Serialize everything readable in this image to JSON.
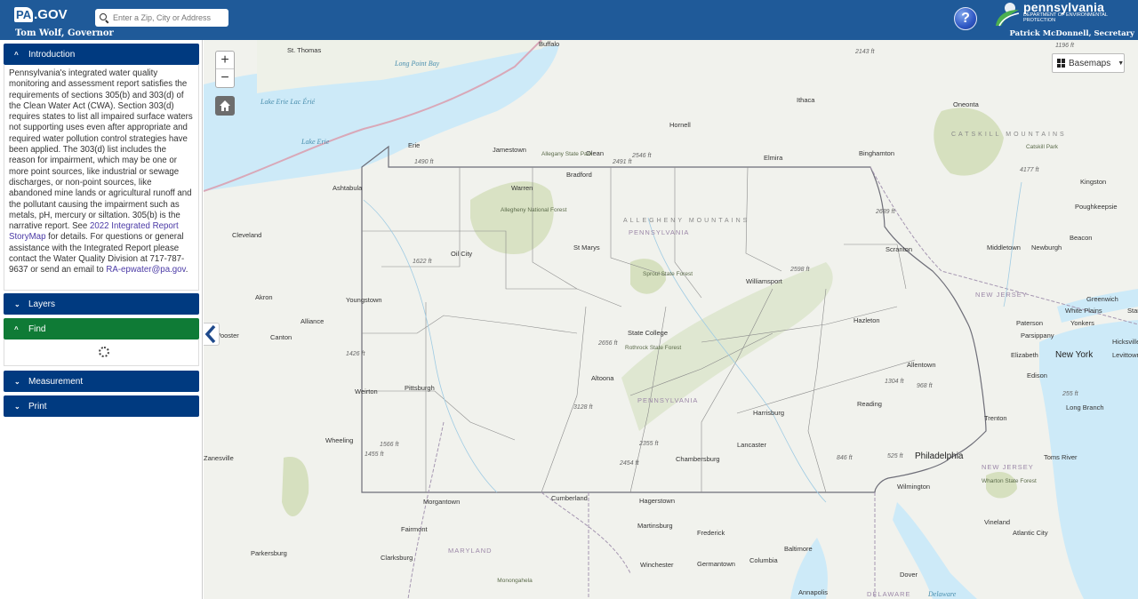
{
  "header": {
    "logo_pa": "PA",
    "logo_gov": ".GOV",
    "governor": "Tom Wolf, Governor",
    "search_placeholder": "Enter a Zip, City or Address",
    "help_label": "?",
    "dept_title": "pennsylvania",
    "dept_subtitle": "DEPARTMENT OF ENVIRONMENTAL PROTECTION",
    "secretary": "Patrick McDonnell, Secretary"
  },
  "sidebar": {
    "panels": [
      {
        "label": "Introduction",
        "expanded": true
      },
      {
        "label": "Layers",
        "expanded": false
      },
      {
        "label": "Find",
        "expanded": true,
        "loading": true
      },
      {
        "label": "Measurement",
        "expanded": false
      },
      {
        "label": "Print",
        "expanded": false
      }
    ],
    "intro": {
      "text_before_link": "Pennsylvania's integrated water quality monitoring and assessment report satisfies the requirements of sections 305(b) and 303(d) of the Clean Water Act (CWA). Section 303(d) requires states to list all impaired surface waters not supporting uses even after appropriate and required water pollution control strategies have been applied. The 303(d) list includes the reason for impairment, which may be one or more point sources, like industrial or sewage discharges, or non-point sources, like abandoned mine lands or agricultural runoff and the pollutant causing the impairment such as metals, pH, mercury or siltation. 305(b) is the narrative report. See ",
      "link_storymap": "2022 Integrated Report StoryMap",
      "text_middle": " for details. For questions or general assistance with the Integrated Report please contact the Water Quality Division at 717-787-9637 or send an email to ",
      "link_email": "RA-epwater@pa.gov",
      "text_end": "."
    }
  },
  "map": {
    "zoom_in": "+",
    "zoom_out": "−",
    "basemaps_label": "Basemaps",
    "colors": {
      "water": "#cdeaf8",
      "land": "#f1f2ed",
      "forest": "#d6e0bf",
      "border": "#6e6e78",
      "panel": "#003a80",
      "panel_active": "#0f7b36",
      "header": "#1f5a99"
    },
    "cities": [
      "Buffalo",
      "St. Thomas",
      "Ithaca",
      "Hornell",
      "Oneonta",
      "Jamestown",
      "Olean",
      "Elmira",
      "Binghamton",
      "Erie",
      "Bradford",
      "Ashtabula",
      "Warren",
      "Kingston",
      "Poughkeepsie",
      "Cleveland",
      "St Marys",
      "Oil City",
      "Beacon",
      "Middletown",
      "Newburgh",
      "Scranton",
      "Williamsport",
      "Akron",
      "Youngstown",
      "Greenwich",
      "Alliance",
      "Hazleton",
      "White Plains",
      "Stamford",
      "Paterson",
      "Yonkers",
      "Parsippany",
      "Hicksville",
      "State College",
      "Canton",
      "Wooster",
      "Elizabeth",
      "New York",
      "Levittown",
      "Allentown",
      "Edison",
      "Weirton",
      "Pittsburgh",
      "Altoona",
      "Long Branch",
      "Harrisburg",
      "Reading",
      "Trenton",
      "Wheeling",
      "Lancaster",
      "Zanesville",
      "Philadelphia",
      "Chambersburg",
      "Toms River",
      "Wilmington",
      "Morgantown",
      "Cumberland",
      "Hagerstown",
      "Vineland",
      "Fairmont",
      "Martinsburg",
      "Frederick",
      "Atlantic City",
      "Parkersburg",
      "Baltimore",
      "Clarksburg",
      "Columbia",
      "Germantown",
      "Winchester",
      "Dover",
      "Annapolis"
    ],
    "water_labels": [
      "Long Point Bay",
      "Lake Erie Lac Érié",
      "Lake Erie",
      "Delaware"
    ],
    "region_labels": [
      "ALLEGHENY MOUNTAINS",
      "CATSKILL MOUNTAINS",
      "PENNSYLVANIA",
      "PENNSYLVANIA",
      "NEW JERSEY",
      "NEW JERSEY",
      "MARYLAND",
      "DELAWARE"
    ],
    "park_labels": [
      "Allegany State Park",
      "Allegheny National Forest",
      "Sproul State Forest",
      "Rothrock State Forest",
      "Catskill Park",
      "Wharton State Forest",
      "Monongahela"
    ],
    "elevations": [
      "1196 ft",
      "2143 ft",
      "2546 ft",
      "2491 ft",
      "1490 ft",
      "4177 ft",
      "2689 ft",
      "1622 ft",
      "2598 ft",
      "2656 ft",
      "1426 ft",
      "1304 ft",
      "968 ft",
      "3128 ft",
      "255 ft",
      "1566 ft",
      "2355 ft",
      "1455 ft",
      "2454 ft",
      "846 ft",
      "525 ft"
    ]
  }
}
